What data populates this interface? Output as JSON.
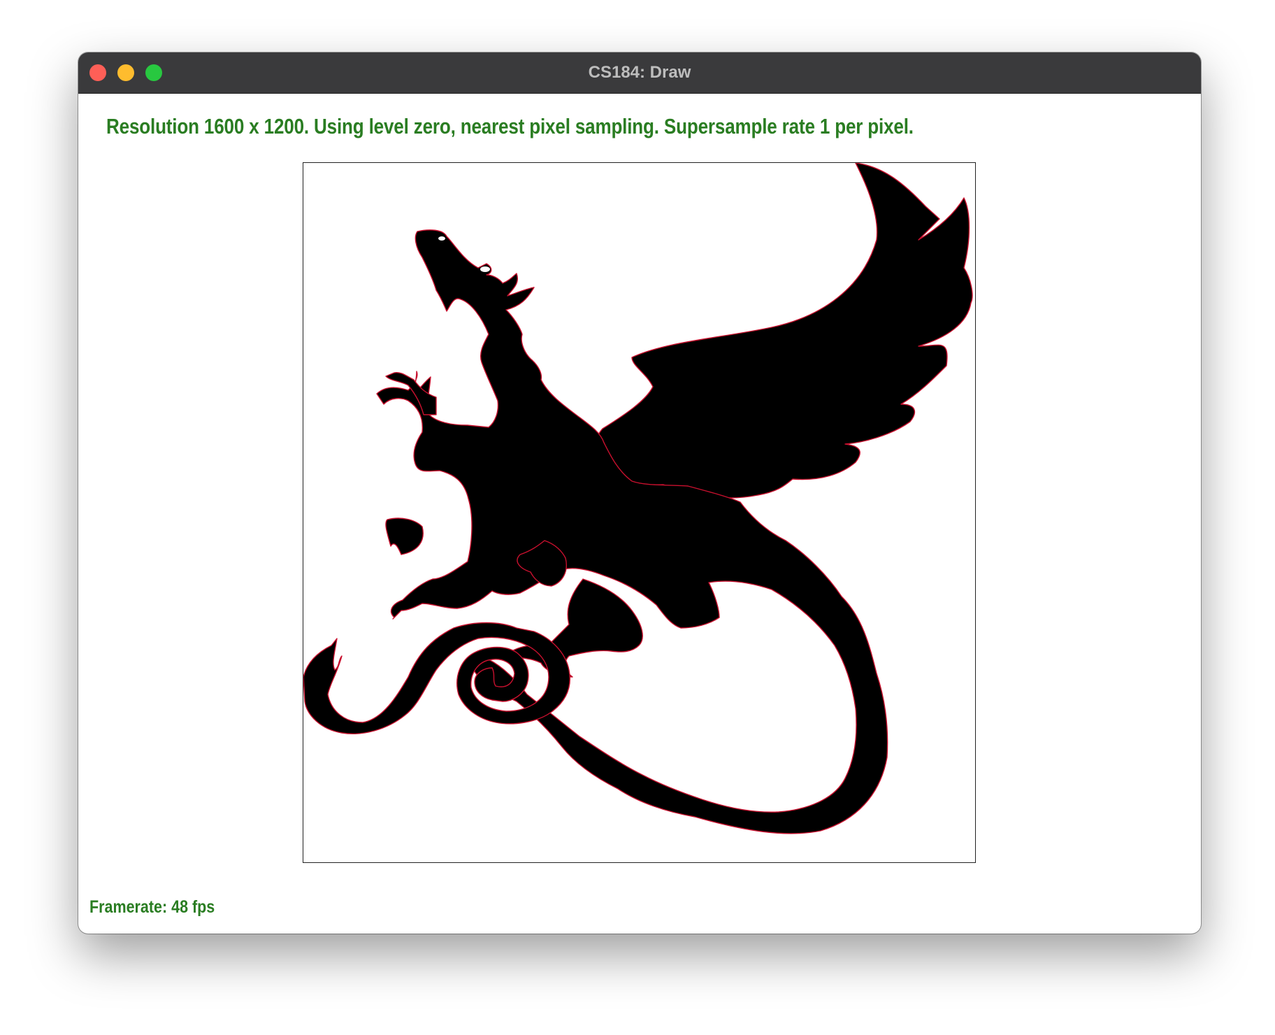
{
  "window": {
    "title": "CS184: Draw",
    "controls": [
      "close",
      "minimize",
      "zoom"
    ]
  },
  "status": {
    "text": "Resolution 1600 x 1200. Using level zero, nearest pixel sampling. Supersample rate 1 per pixel."
  },
  "canvas": {
    "image": "dragon-silhouette",
    "fill_color": "#000000",
    "edge_color": "#c8102e",
    "background": "#ffffff"
  },
  "footer": {
    "framerate": "Framerate: 48 fps"
  },
  "colors": {
    "status_text": "#2a7d22",
    "titlebar": "#3a3a3c",
    "close": "#fe5f57",
    "minimize": "#febc2e",
    "zoom": "#28c840"
  }
}
